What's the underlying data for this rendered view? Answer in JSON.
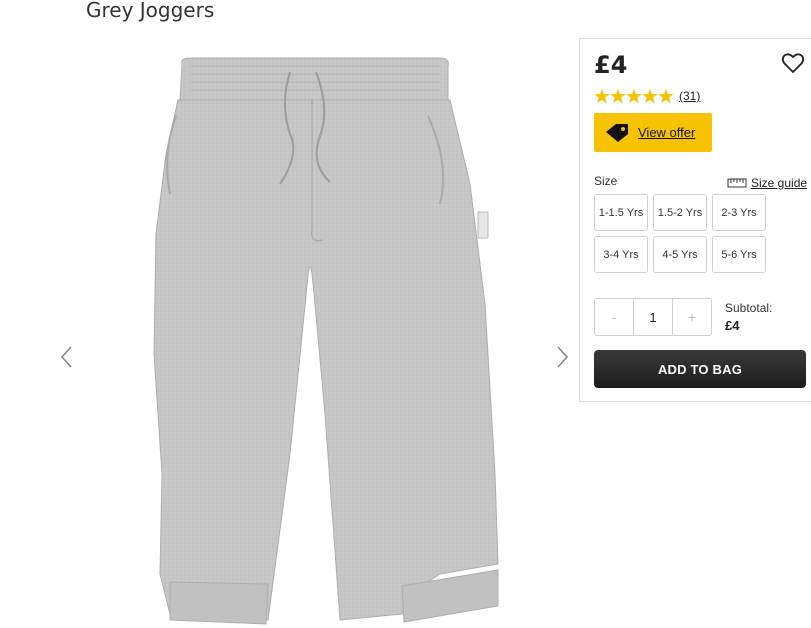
{
  "product": {
    "title": "Grey Joggers",
    "image_alt": "grey-joggers-image"
  },
  "buy_box": {
    "price": "£4",
    "rating_stars": 5,
    "rating_count": "(31)",
    "offer_label": "View offer",
    "size_label": "Size",
    "size_guide_label": "Size guide",
    "sizes": [
      "1-1.5 Yrs",
      "1.5-2 Yrs",
      "2-3 Yrs",
      "3-4 Yrs",
      "4-5 Yrs",
      "5-6 Yrs"
    ],
    "quantity": {
      "minus": "-",
      "value": "1",
      "plus": "+"
    },
    "subtotal_label": "Subtotal:",
    "subtotal_value": "£4",
    "add_to_bag_label": "ADD TO BAG"
  },
  "colors": {
    "star": "#f7c300",
    "offer_bg": "#f7c300",
    "button_dark": "#2a2a2a",
    "product_grey": "#c4c4c4"
  },
  "icons": {
    "wishlist": "heart-icon",
    "offer": "tag-icon",
    "size_guide": "ruler-icon",
    "prev": "chevron-left-icon",
    "next": "chevron-right-icon"
  }
}
